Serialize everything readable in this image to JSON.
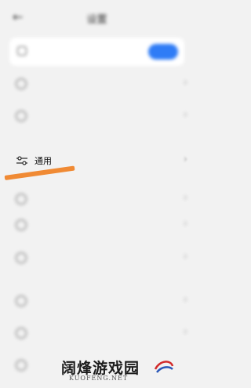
{
  "header": {
    "title": "设置",
    "back_icon": "back-arrow-icon"
  },
  "promo": {
    "text": "",
    "subtext": "",
    "button": ""
  },
  "items": [
    {
      "label": "",
      "icon": "circle-icon"
    },
    {
      "label": "",
      "icon": "search-icon"
    },
    {
      "label": "通用",
      "icon": "sliders-icon"
    },
    {
      "label": "",
      "icon": "circle-icon"
    },
    {
      "label": "",
      "icon": "circle-icon"
    },
    {
      "label": "",
      "icon": "circle-icon"
    },
    {
      "label": "",
      "icon": "circle-icon"
    },
    {
      "label": "",
      "icon": "circle-icon"
    },
    {
      "label": "",
      "icon": "circle-icon"
    }
  ],
  "annotation": {
    "arrow_color": "#f08a34"
  },
  "watermark": {
    "text": "阔烽游戏园",
    "domain": "KUOFENG.NET"
  },
  "colors": {
    "accent": "#2f7cf6",
    "background": "#f2f2f2"
  }
}
